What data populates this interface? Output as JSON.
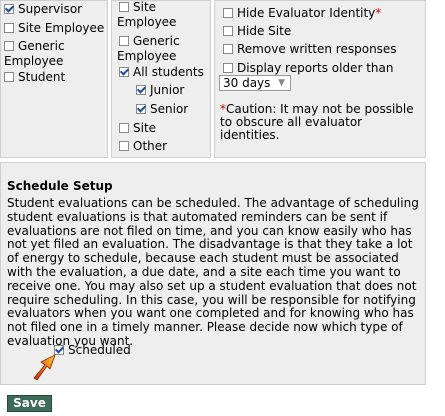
{
  "evaluators": {
    "supervisor": "Supervisor",
    "site_employee": "Site Employee",
    "generic_employee": "Generic Employee",
    "student": "Student"
  },
  "subjects": {
    "site_employee": "Site Employee",
    "generic_employee": "Generic Employee",
    "all_students": "All students",
    "junior": "Junior",
    "senior": "Senior",
    "site": "Site",
    "other": "Other"
  },
  "options": {
    "hide_evaluator_identity": "Hide Evaluator Identity",
    "required_mark": "*",
    "hide_site": "Hide Site",
    "remove_written": "Remove written responses",
    "display_older": "Display reports older than",
    "older_than_value": "30 days",
    "caution_star": "*",
    "caution_text": "Caution: It may not be possible to obscure all evaluator identities."
  },
  "schedule": {
    "title": "Schedule Setup",
    "body": "Student evaluations can be scheduled. The advantage of scheduling student evaluations is that automated reminders can be sent if evaluations are not filed on time, and you can know easily who has not yet filed an evaluation. The disadvantage is that they take a lot of energy to schedule, because each student must be associated with the evaluation, a due date, and a site each time you want to receive one. You may also set up a student evaluation that does not require scheduling. In this case, you will be responsible for notifying evaluators when you want one completed and for knowing who has not filed one in a timely manner. Please decide now which type of evaluation you want.",
    "scheduled_label": "Scheduled"
  },
  "save_label": "Save"
}
